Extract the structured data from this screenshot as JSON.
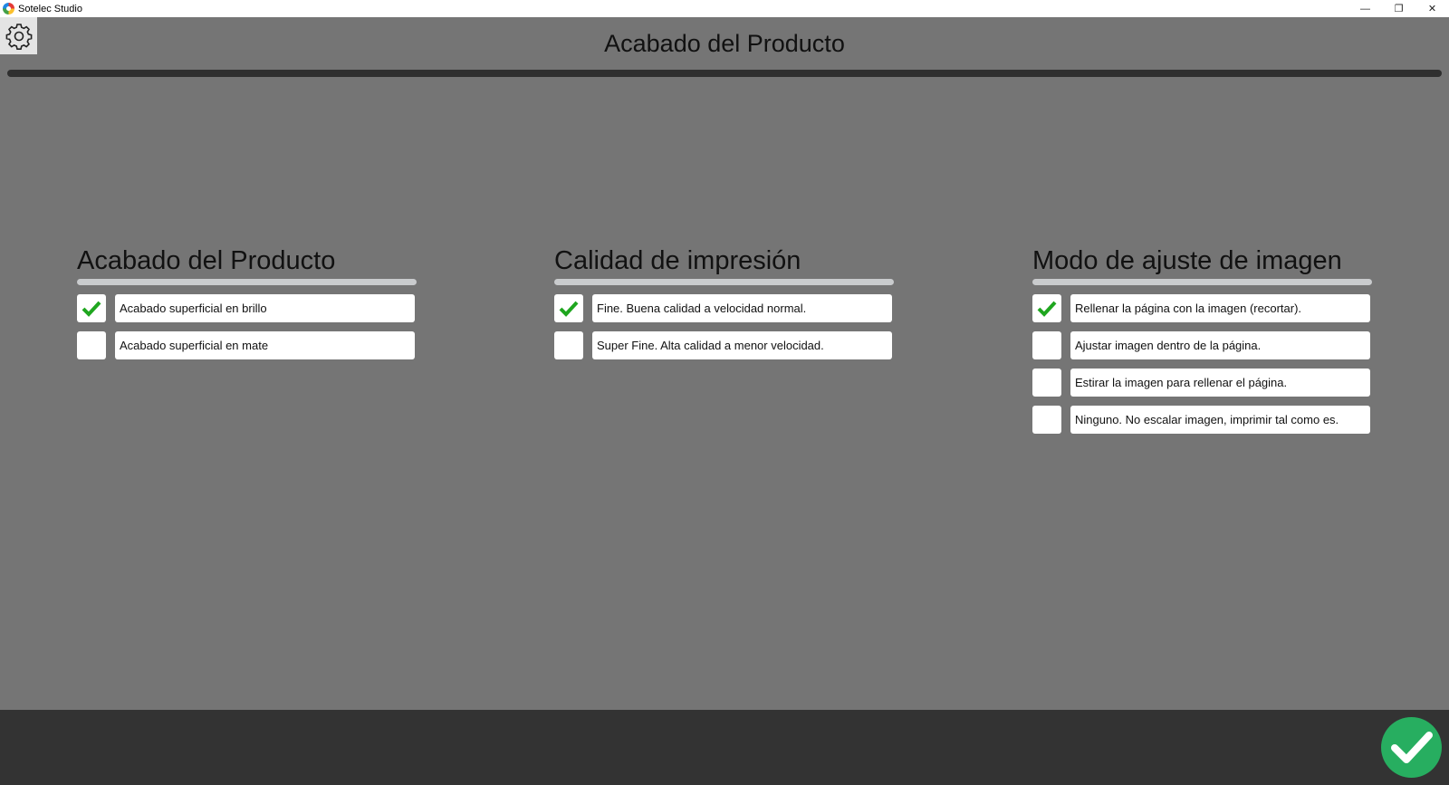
{
  "window": {
    "title": "Sotelec Studio",
    "controls": {
      "minimize": "—",
      "restore": "❐",
      "close": "✕"
    }
  },
  "header": {
    "title": "Acabado del Producto"
  },
  "icons": {
    "settings": "gear-icon",
    "check": "check-icon",
    "confirm": "confirm-check-icon"
  },
  "colors": {
    "background": "#757575",
    "footer": "#333333",
    "check_green": "#1fa61f",
    "confirm_green": "#27ae60"
  },
  "sections": [
    {
      "title": "Acabado del Producto",
      "options": [
        {
          "label": "Acabado superficial en brillo",
          "checked": true
        },
        {
          "label": "Acabado superficial en mate",
          "checked": false
        }
      ]
    },
    {
      "title": "Calidad de impresión",
      "options": [
        {
          "label": "Fine. Buena calidad a velocidad normal.",
          "checked": true
        },
        {
          "label": "Super Fine. Alta calidad a menor velocidad.",
          "checked": false
        }
      ]
    },
    {
      "title": "Modo de ajuste de imagen",
      "options": [
        {
          "label": "Rellenar la página con la imagen (recortar).",
          "checked": true
        },
        {
          "label": "Ajustar imagen dentro de la página.",
          "checked": false
        },
        {
          "label": "Estirar la imagen para rellenar el página.",
          "checked": false
        },
        {
          "label": "Ninguno. No escalar imagen, imprimir tal como es.",
          "checked": false
        }
      ]
    }
  ]
}
